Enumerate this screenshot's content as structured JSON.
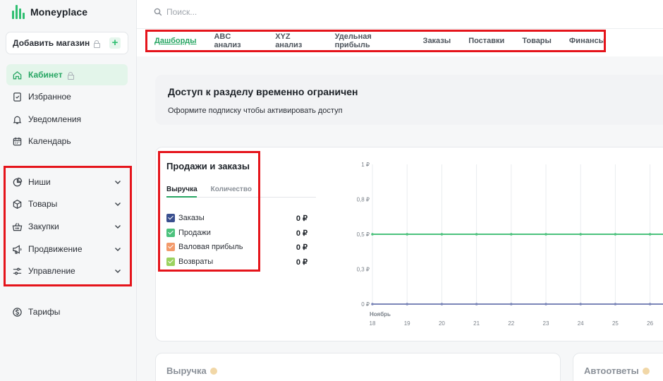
{
  "app": {
    "name": "Moneyplace"
  },
  "sidebar": {
    "add_store_label": "Добавить магазин",
    "primary": [
      {
        "label": "Кабинет",
        "icon": "home-icon",
        "active": true,
        "locked": true
      },
      {
        "label": "Избранное",
        "icon": "bookmark-icon"
      },
      {
        "label": "Уведомления",
        "icon": "bell-icon"
      },
      {
        "label": "Календарь",
        "icon": "calendar-icon"
      }
    ],
    "sections": [
      {
        "label": "Ниши",
        "icon": "pie-icon"
      },
      {
        "label": "Товары",
        "icon": "box-icon"
      },
      {
        "label": "Закупки",
        "icon": "basket-icon"
      },
      {
        "label": "Продвижение",
        "icon": "megaphone-icon"
      },
      {
        "label": "Управление",
        "icon": "sliders-icon"
      }
    ],
    "tariffs_label": "Тарифы"
  },
  "search": {
    "placeholder": "Поиск..."
  },
  "tabs": [
    {
      "label": "Дашборды",
      "active": true
    },
    {
      "label": "ABC анализ"
    },
    {
      "label": "XYZ анализ"
    },
    {
      "label": "Удельная прибыль"
    },
    {
      "label": "Заказы"
    },
    {
      "label": "Поставки"
    },
    {
      "label": "Товары"
    },
    {
      "label": "Финансы"
    }
  ],
  "notice": {
    "title": "Доступ к разделу временно ограничен",
    "subtitle": "Оформите подписку чтобы активировать доступ"
  },
  "sales_card": {
    "title": "Продажи и заказы",
    "subtabs": [
      "Выручка",
      "Количество"
    ],
    "legend": [
      {
        "label": "Заказы",
        "value": "0 ₽",
        "color": "#3a4f8f"
      },
      {
        "label": "Продажи",
        "value": "0 ₽",
        "color": "#4cc27d"
      },
      {
        "label": "Валовая прибыль",
        "value": "0 ₽",
        "color": "#f39a6b"
      },
      {
        "label": "Возвраты",
        "value": "0 ₽",
        "color": "#9bd25f"
      }
    ]
  },
  "chart_data": {
    "type": "line",
    "month_label": "Ноябрь",
    "categories": [
      "18",
      "19",
      "20",
      "21",
      "22",
      "23",
      "24",
      "25",
      "26"
    ],
    "y_ticks": [
      "0 ₽",
      "0,3 ₽",
      "0,5 ₽",
      "0,8 ₽",
      "1 ₽"
    ],
    "ylim": [
      0,
      1
    ],
    "series": [
      {
        "name": "Заказы",
        "color": "#7b86b8",
        "values": [
          0,
          0,
          0,
          0,
          0,
          0,
          0,
          0,
          0
        ]
      },
      {
        "name": "Продажи",
        "color": "#4cc27d",
        "values": [
          0.5,
          0.5,
          0.5,
          0.5,
          0.5,
          0.5,
          0.5,
          0.5,
          0.5
        ]
      }
    ]
  },
  "bottom": {
    "revenue_title": "Выручка",
    "autoreply_title": "Автоответы"
  }
}
